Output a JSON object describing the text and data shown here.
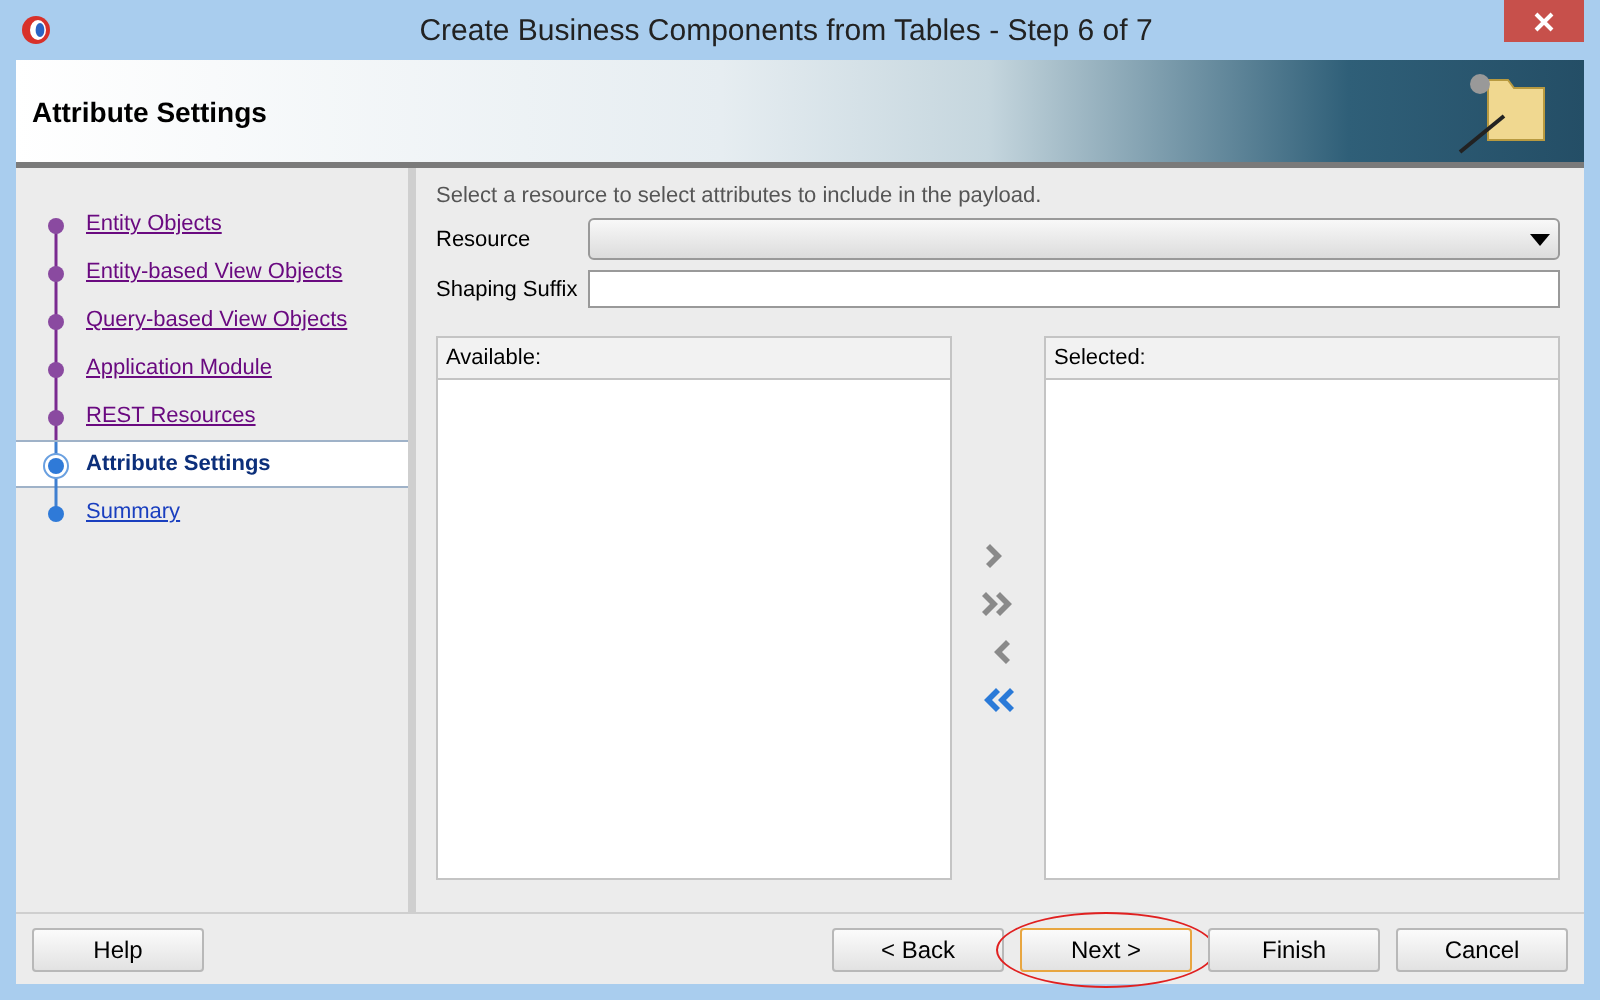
{
  "window": {
    "title": "Create Business Components from Tables - Step 6 of 7"
  },
  "header": {
    "title": "Attribute Settings"
  },
  "steps": [
    {
      "label": "Entity Objects",
      "visited": true,
      "selected": false
    },
    {
      "label": "Entity-based View Objects",
      "visited": true,
      "selected": false
    },
    {
      "label": "Query-based View Objects",
      "visited": true,
      "selected": false
    },
    {
      "label": "Application Module",
      "visited": true,
      "selected": false
    },
    {
      "label": "REST Resources",
      "visited": true,
      "selected": false
    },
    {
      "label": "Attribute Settings",
      "visited": false,
      "selected": true
    },
    {
      "label": "Summary",
      "visited": false,
      "selected": false
    }
  ],
  "instructions": "Select a resource to select attributes to include in the payload.",
  "resource": {
    "label": "Resource"
  },
  "shaping_suffix": {
    "label": "Shaping Suffix"
  },
  "available": {
    "heading": "Available:"
  },
  "selected_list": {
    "heading": "Selected:"
  },
  "move_buttons": [
    {
      "kind": "one_right",
      "disabled": true
    },
    {
      "kind": "all_right",
      "disabled": true
    },
    {
      "kind": "one_left",
      "disabled": true
    },
    {
      "kind": "all_left",
      "disabled": false
    }
  ],
  "buttons": [
    {
      "label": "Help",
      "highlighted": false
    },
    {
      "label": "< Back",
      "highlighted": false
    },
    {
      "label": "Next >",
      "highlighted": true
    },
    {
      "label": "Finish",
      "highlighted": false
    },
    {
      "label": "Cancel",
      "highlighted": false
    }
  ]
}
